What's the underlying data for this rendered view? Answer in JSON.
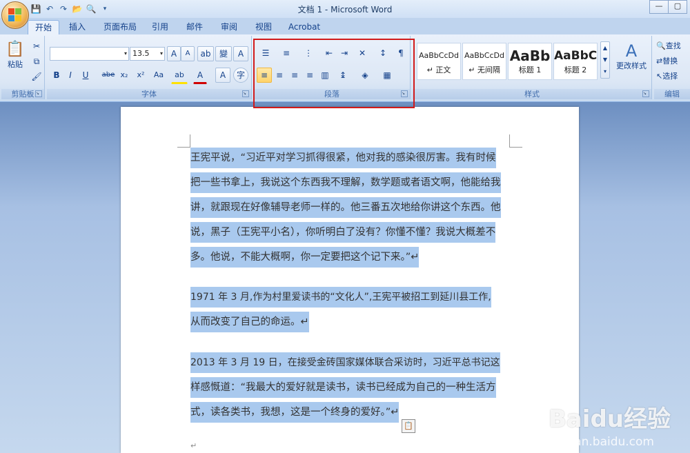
{
  "app": {
    "title": "文档 1 - Microsoft Word"
  },
  "window_controls": {
    "minimize": "—",
    "restore": "▢"
  },
  "qat": {
    "save_icon": "save-icon",
    "undo_icon": "undo-icon",
    "redo_icon": "redo-icon",
    "open_icon": "open-icon",
    "preview_icon": "print-preview-icon"
  },
  "tabs": [
    {
      "label": "开始"
    },
    {
      "label": "插入"
    },
    {
      "label": "页面布局"
    },
    {
      "label": "引用"
    },
    {
      "label": "邮件"
    },
    {
      "label": "审阅"
    },
    {
      "label": "视图"
    },
    {
      "label": "Acrobat"
    }
  ],
  "clipboard": {
    "paste_label": "粘贴",
    "group_label": "剪贴板"
  },
  "font": {
    "font_name": "",
    "font_size": "13.5",
    "group_label": "字体",
    "bold": "B",
    "italic": "I",
    "underline": "U",
    "strike": "abe",
    "sub": "x₂",
    "sup": "x²",
    "case": "Aa",
    "highlight": "ab",
    "color": "A",
    "grow": "A",
    "shrink": "A",
    "clear": "A"
  },
  "paragraph": {
    "group_label": "段落"
  },
  "styles": {
    "group_label": "样式",
    "items": [
      {
        "preview": "AaBbCcDd",
        "name": "↵ 正文"
      },
      {
        "preview": "AaBbCcDd",
        "name": "↵ 无间隔"
      },
      {
        "preview": "AaBb",
        "name": "标题 1"
      },
      {
        "preview": "AaBbC",
        "name": "标题 2"
      }
    ],
    "change_label": "更改样式"
  },
  "editing": {
    "group_label": "编辑",
    "find": "查找",
    "replace": "替换",
    "select": "选择"
  },
  "document": {
    "paragraphs": [
      {
        "lines": [
          "王宪平说，“习近平对学习抓得很紧，他对我的感染很厉害。我有时候",
          "把一些书拿上，我说这个东西我不理解，数学题或者语文啊，他能给我",
          "讲，就跟现在好像辅导老师一样的。他三番五次地给你讲这个东西。他",
          "说，黑子（王宪平小名），你听明白了没有？你懂不懂？我说大概差不",
          "多。他说，不能大概啊，你一定要把这个记下来。”↵"
        ]
      },
      {
        "lines": [
          "1971 年 3 月,作为村里爱读书的“文化人”,王宪平被招工到延川县工作,",
          "从而改变了自己的命运。↵"
        ]
      },
      {
        "lines": [
          "2013 年 3 月 19 日，在接受金砖国家媒体联合采访时，习近平总书记这",
          "样感慨道：“我最大的爱好就是读书，读书已经成为自己的一种生活方",
          "式，读各类书，我想，这是一个终身的爱好。”↵"
        ]
      }
    ],
    "final_mark": "↵"
  },
  "watermark": {
    "text": "Baidu经验",
    "url": "jingyan.baidu.com"
  }
}
